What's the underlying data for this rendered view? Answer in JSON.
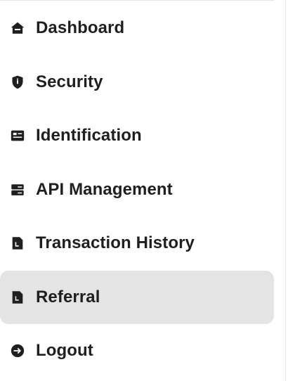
{
  "menu": {
    "items": [
      {
        "label": "Dashboard",
        "icon": "home-icon",
        "active": false
      },
      {
        "label": "Security",
        "icon": "shield-icon",
        "active": false
      },
      {
        "label": "Identification",
        "icon": "id-card-icon",
        "active": false
      },
      {
        "label": "API Management",
        "icon": "server-icon",
        "active": false
      },
      {
        "label": "Transaction History",
        "icon": "document-icon",
        "active": false
      },
      {
        "label": "Referral",
        "icon": "document-icon",
        "active": true
      },
      {
        "label": "Logout",
        "icon": "logout-icon",
        "active": false
      }
    ]
  },
  "colors": {
    "text": "#1f1f1f",
    "icon": "#1f1f1f",
    "active_background": "#e4e4e4",
    "background": "#ffffff"
  }
}
